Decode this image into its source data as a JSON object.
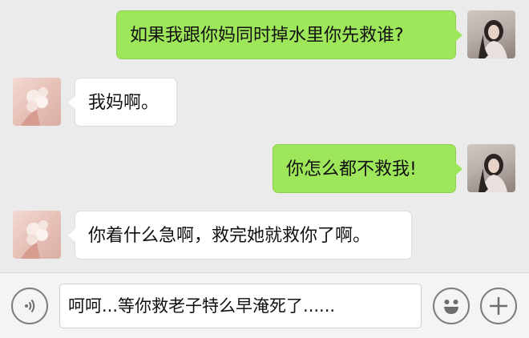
{
  "messages": [
    {
      "side": "right",
      "text": "如果我跟你妈同时掉水里你先救谁?"
    },
    {
      "side": "left",
      "text": "我妈啊。"
    },
    {
      "side": "right",
      "text": "你怎么都不救我!"
    },
    {
      "side": "left",
      "text": "你着什么急啊，救完她就救你了啊。"
    }
  ],
  "input": {
    "value": "呵呵...等你救老子特么早淹死了......"
  },
  "icons": {
    "voice": "voice-icon",
    "emoji": "emoji-icon",
    "add": "plus-icon"
  },
  "colors": {
    "sent_bubble": "#9ee75a",
    "received_bubble": "#ffffff",
    "background": "#ebebeb"
  }
}
